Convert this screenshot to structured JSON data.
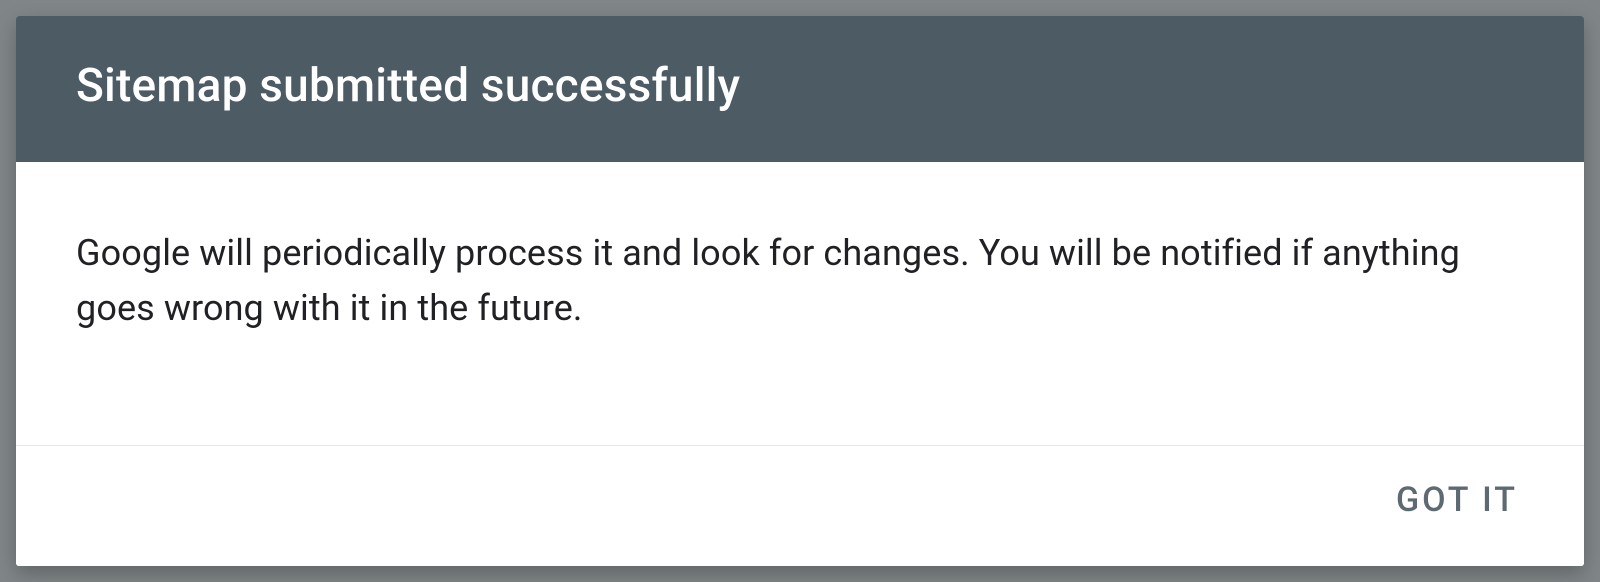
{
  "dialog": {
    "title": "Sitemap submitted successfully",
    "message": "Google will periodically process it and look for changes. You will be notified if anything goes wrong with it in the future.",
    "confirm_label": "GOT IT"
  }
}
